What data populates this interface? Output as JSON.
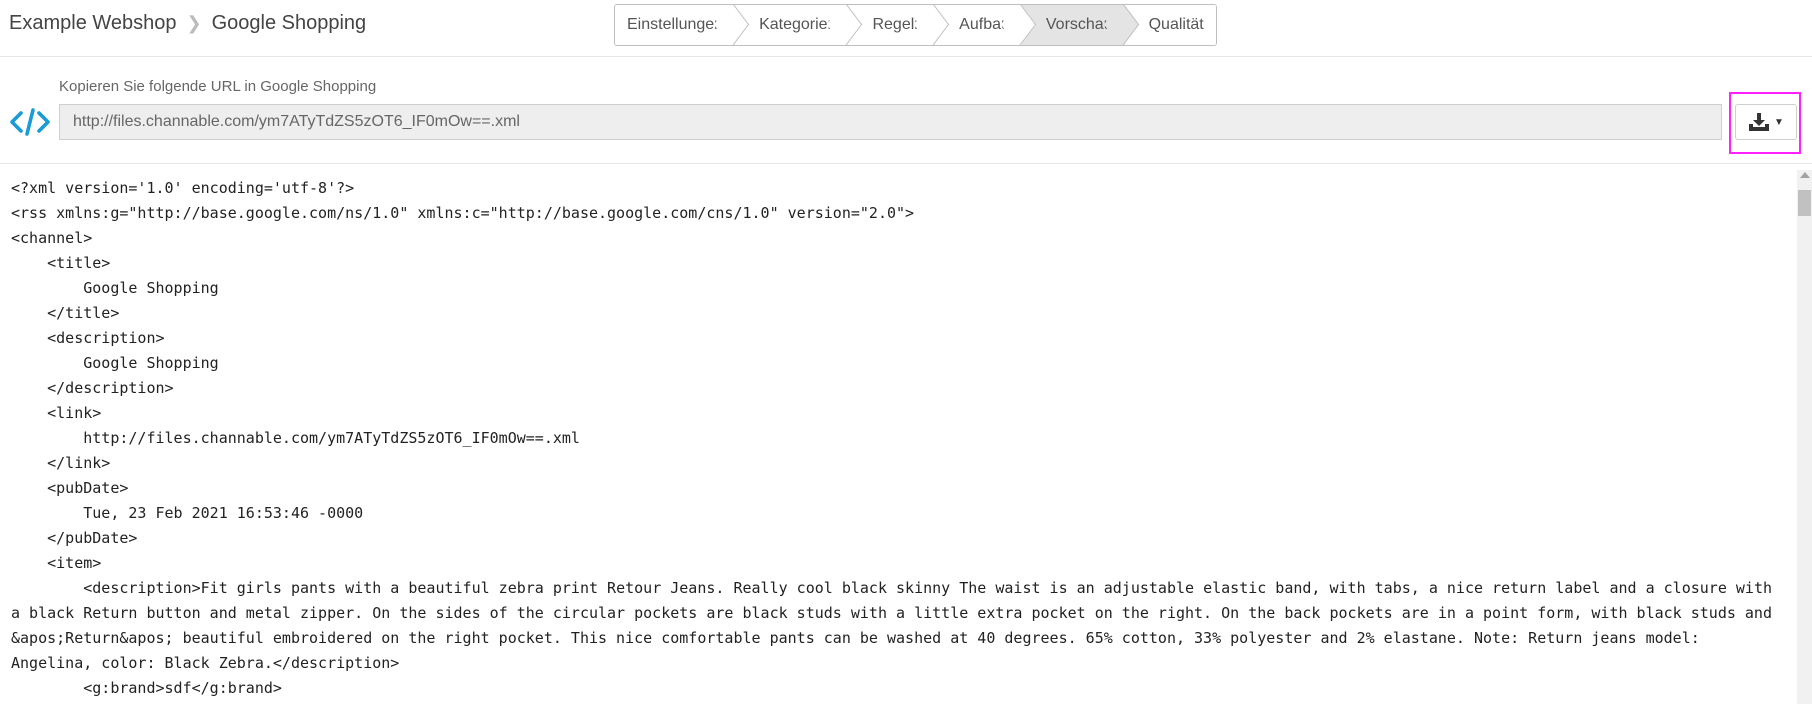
{
  "breadcrumb": {
    "shop": "Example Webshop",
    "separator": ">",
    "page": "Google Shopping"
  },
  "steps": [
    "Einstellungen",
    "Kategorien",
    "Regeln",
    "Aufbau",
    "Vorschau",
    "Qualität"
  ],
  "active_step": "Vorschau",
  "url_section": {
    "label": "Kopieren Sie folgende URL in Google Shopping",
    "url": "http://files.channable.com/ym7ATyTdZS5zOT6_IF0mOw==.xml",
    "icon": "code-icon",
    "download_icon": "download-icon",
    "dropdown_caret": "▼"
  },
  "colors": {
    "brand_blue": "#1a9ad6",
    "highlight": "#ff22ff",
    "active_step_bg": "#e4e4e4",
    "url_bg": "#eeeeee"
  },
  "xml_lines": [
    "<?xml version='1.0' encoding='utf-8'?>",
    "<rss xmlns:g=\"http://base.google.com/ns/1.0\" xmlns:c=\"http://base.google.com/cns/1.0\" version=\"2.0\">",
    "<channel>",
    "    <title>",
    "        Google Shopping",
    "    </title>",
    "    <description>",
    "        Google Shopping",
    "    </description>",
    "    <link>",
    "        http://files.channable.com/ym7ATyTdZS5zOT6_IF0mOw==.xml",
    "    </link>",
    "    <pubDate>",
    "        Tue, 23 Feb 2021 16:53:46 -0000",
    "    </pubDate>",
    "    <item>",
    "        <description>Fit girls pants with a beautiful zebra print Retour Jeans. Really cool black skinny The waist is an adjustable elastic band, with tabs, a nice return label and a closure with a black Return button and metal zipper. On the sides of the circular pockets are black studs with a little extra pocket on the right. On the back pockets are in a point form, with black studs and &apos;Return&apos; beautiful embroidered on the right pocket. This nice comfortable pants can be washed at 40 degrees. 65% cotton, 33% polyester and 2% elastane. Note: Return jeans model: Angelina, color: Black Zebra.</description>",
    "        <g:brand>sdf</g:brand>"
  ]
}
